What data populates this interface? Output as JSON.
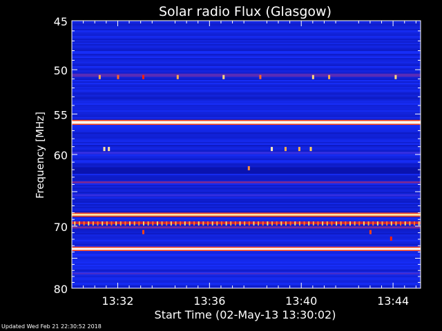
{
  "chart_data": {
    "type": "heatmap",
    "title": "Solar radio Flux (Glasgow)",
    "xlabel": "Start Time (02-May-13 13:30:02)",
    "ylabel": "Frequency [MHz]",
    "x_range_minutes": [
      0,
      15.2
    ],
    "x_ticks": [
      {
        "label": "13:32",
        "minute": 2
      },
      {
        "label": "13:36",
        "minute": 6
      },
      {
        "label": "13:40",
        "minute": 10
      },
      {
        "label": "13:44",
        "minute": 14
      }
    ],
    "y_range_mhz": [
      45,
      80
    ],
    "y_ticks": [
      45,
      50,
      55,
      60,
      65,
      70,
      75,
      80
    ],
    "y_tick_labels": [
      "45",
      "50",
      "55",
      "60",
      "",
      "70",
      "",
      "80"
    ],
    "y_scale": "log",
    "grid": false,
    "colormap": [
      "#00007a",
      "#1830ff",
      "#ff2000",
      "#ffd060",
      "#ffffff"
    ],
    "background_level": 0.18,
    "bands": [
      {
        "freq": 50.6,
        "intensity": 0.32,
        "width": 0.35
      },
      {
        "freq": 56.0,
        "intensity": 0.97,
        "width": 0.35
      },
      {
        "freq": 59.8,
        "intensity": 0.28,
        "width": 0.3
      },
      {
        "freq": 62.1,
        "intensity": 0.1,
        "width": 0.9
      },
      {
        "freq": 63.7,
        "intensity": 0.36,
        "width": 0.25
      },
      {
        "freq": 65.5,
        "intensity": 0.28,
        "width": 0.3
      },
      {
        "freq": 68.3,
        "intensity": 0.85,
        "width": 0.3
      },
      {
        "freq": 69.5,
        "intensity": 0.45,
        "width": 0.4
      },
      {
        "freq": 70.2,
        "intensity": 0.35,
        "width": 0.3
      },
      {
        "freq": 73.5,
        "intensity": 0.98,
        "width": 0.35
      },
      {
        "freq": 77.5,
        "intensity": 0.3,
        "width": 0.3
      }
    ],
    "bursts": [
      {
        "minute": 1.2,
        "freq": 50.8,
        "intensity": 0.7
      },
      {
        "minute": 2.0,
        "freq": 50.8,
        "intensity": 0.6
      },
      {
        "minute": 3.1,
        "freq": 50.8,
        "intensity": 0.5
      },
      {
        "minute": 4.6,
        "freq": 50.8,
        "intensity": 0.7
      },
      {
        "minute": 6.6,
        "freq": 50.8,
        "intensity": 0.8
      },
      {
        "minute": 8.2,
        "freq": 50.8,
        "intensity": 0.6
      },
      {
        "minute": 10.5,
        "freq": 50.8,
        "intensity": 0.8
      },
      {
        "minute": 11.2,
        "freq": 50.8,
        "intensity": 0.7
      },
      {
        "minute": 14.1,
        "freq": 50.8,
        "intensity": 0.8
      },
      {
        "minute": 1.4,
        "freq": 59.3,
        "intensity": 0.85
      },
      {
        "minute": 1.6,
        "freq": 59.3,
        "intensity": 0.85
      },
      {
        "minute": 8.7,
        "freq": 59.3,
        "intensity": 0.9
      },
      {
        "minute": 9.3,
        "freq": 59.3,
        "intensity": 0.7
      },
      {
        "minute": 9.9,
        "freq": 59.3,
        "intensity": 0.7
      },
      {
        "minute": 10.4,
        "freq": 59.3,
        "intensity": 0.75
      },
      {
        "minute": 7.7,
        "freq": 61.8,
        "intensity": 0.65
      },
      {
        "minute": 3.1,
        "freq": 70.9,
        "intensity": 0.55
      },
      {
        "minute": 13.0,
        "freq": 70.9,
        "intensity": 0.55
      },
      {
        "minute": 13.9,
        "freq": 71.9,
        "intensity": 0.5
      }
    ],
    "burst_train": {
      "freq": 69.6,
      "start_minute": 0.1,
      "end_minute": 15.1,
      "step_minute": 0.2,
      "intensity": 0.78
    }
  },
  "footer": {
    "updated_text": "Updated Wed Feb 21 22:30:52 2018"
  }
}
